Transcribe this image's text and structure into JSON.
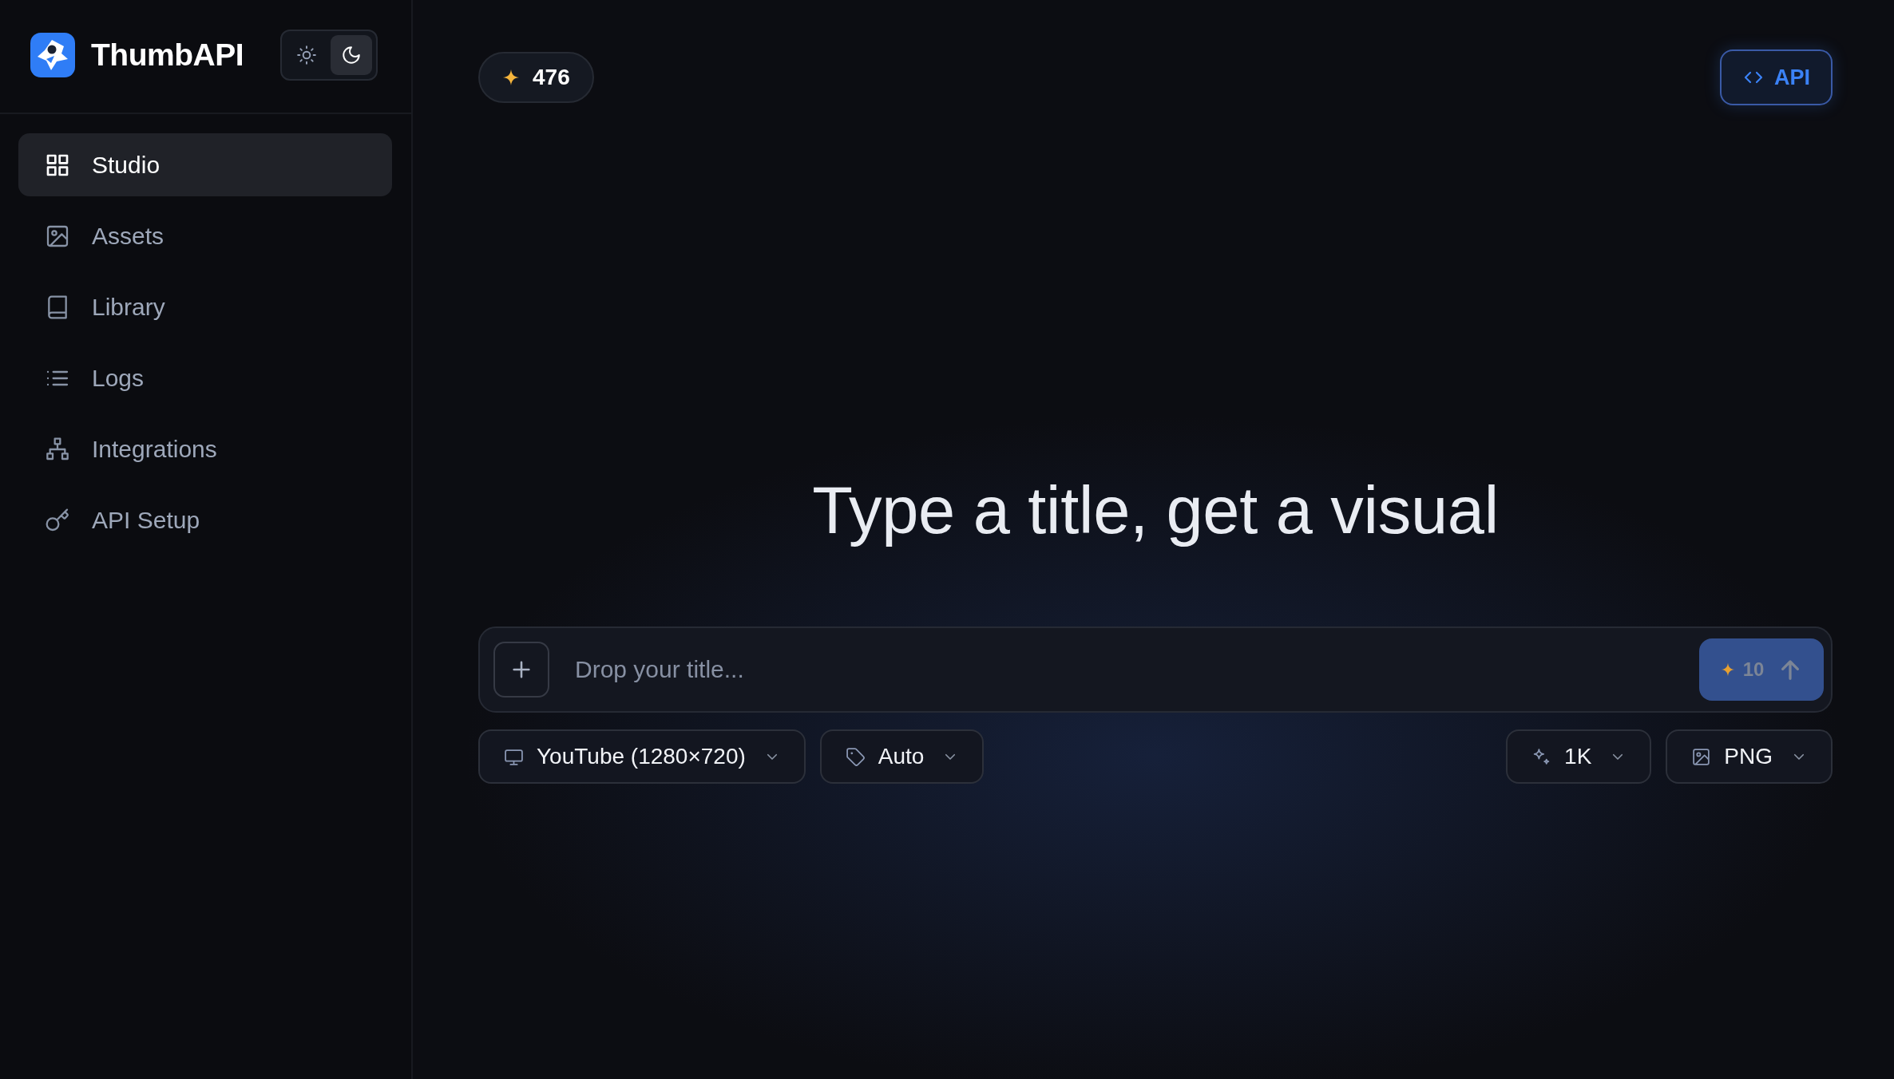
{
  "sidebar": {
    "brand": "ThumbAPI",
    "theme_modes": [
      {
        "kind": "light",
        "selected": false
      },
      {
        "kind": "dark",
        "selected": true
      }
    ],
    "nav_items": [
      {
        "kind": "studio",
        "label": "Studio",
        "selected": true
      },
      {
        "kind": "assets",
        "label": "Assets",
        "selected": false
      },
      {
        "kind": "library",
        "label": "Library",
        "selected": false
      },
      {
        "kind": "logs",
        "label": "Logs",
        "selected": false
      },
      {
        "kind": "integrations",
        "label": "Integrations",
        "selected": false
      },
      {
        "kind": "setup",
        "label": "API Setup",
        "selected": false
      }
    ]
  },
  "header": {
    "credits": "476",
    "api_button": "API"
  },
  "hero_title": "Type a title, get a visual",
  "composer": {
    "placeholder": "Drop your title...",
    "submit": {
      "cost": "10",
      "disabled": true
    }
  },
  "options": {
    "start": [
      {
        "kind": "format",
        "label": "YouTube (1280×720)"
      },
      {
        "kind": "style",
        "label": "Auto"
      }
    ],
    "end": [
      {
        "kind": "resolution",
        "label": "1K"
      },
      {
        "kind": "filetype",
        "label": "PNG"
      }
    ]
  }
}
